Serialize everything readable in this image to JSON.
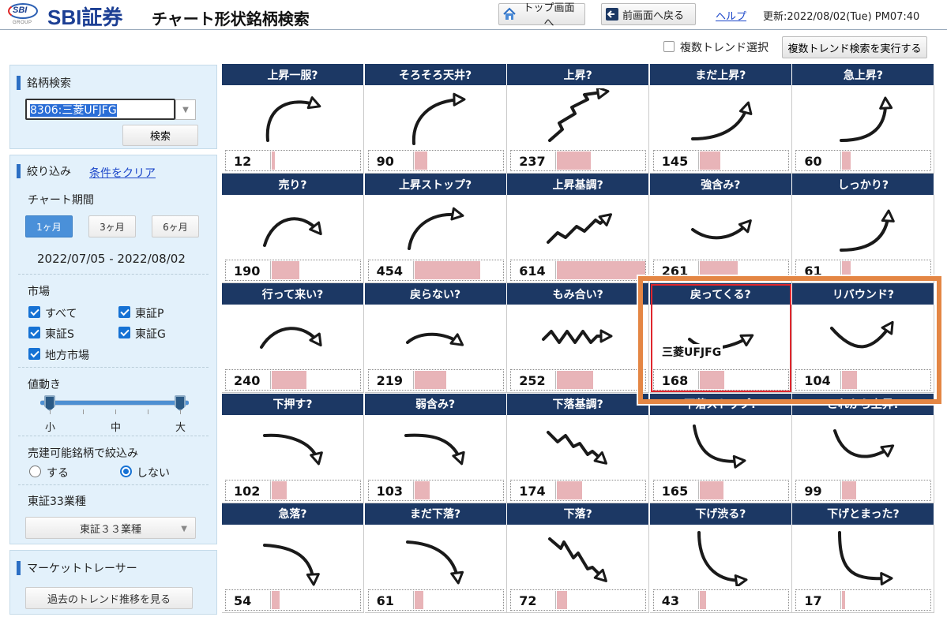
{
  "header": {
    "logo_mark": "SBI",
    "logo_group": "GROUP",
    "brand": "SBI証券",
    "title": "チャート形状銘柄検索",
    "top_button": "トップ画面へ",
    "back_button": "前画面へ戻る",
    "help": "ヘルプ",
    "updated": "更新:2022/08/02(Tue) PM07:40"
  },
  "toolbar": {
    "multi_trend_label": "複数トレンド選択",
    "multi_trend_run": "複数トレンド検索を実行する"
  },
  "sidebar": {
    "search": {
      "title": "銘柄検索",
      "input_value": "8306:三菱UFJFG",
      "button": "検索"
    },
    "filter": {
      "title": "絞り込み",
      "clear": "条件をクリア",
      "period_label": "チャート期間",
      "periods": [
        "1ヶ月",
        "3ヶ月",
        "6ヶ月"
      ],
      "active_period": 0,
      "date_range": "2022/07/05 - 2022/08/02",
      "market_label": "市場",
      "markets": [
        "すべて",
        "東証P",
        "東証S",
        "東証G",
        "地方市場"
      ],
      "volatility_label": "値動き",
      "volatility_ticks": [
        "小",
        "中",
        "大"
      ],
      "shortable_label": "売建可能銘柄で絞込み",
      "shortable_options": [
        "する",
        "しない"
      ],
      "shortable_selected": 1,
      "industry_label": "東証33業種",
      "industry_select": "東証３３業種"
    },
    "tracer": {
      "title": "マーケットトレーサー",
      "button": "過去のトレンド推移を見る"
    }
  },
  "grid": {
    "max_count": 614,
    "cells": [
      {
        "label": "上昇一服?",
        "count": 12
      },
      {
        "label": "そろそろ天井?",
        "count": 90
      },
      {
        "label": "上昇?",
        "count": 237
      },
      {
        "label": "まだ上昇?",
        "count": 145
      },
      {
        "label": "急上昇?",
        "count": 60
      },
      {
        "label": "売り?",
        "count": 190
      },
      {
        "label": "上昇ストップ?",
        "count": 454
      },
      {
        "label": "上昇基調?",
        "count": 614
      },
      {
        "label": "強含み?",
        "count": 261
      },
      {
        "label": "しっかり?",
        "count": 61
      },
      {
        "label": "行って来い?",
        "count": 240
      },
      {
        "label": "戻らない?",
        "count": 219
      },
      {
        "label": "もみ合い?",
        "count": 252
      },
      {
        "label": "戻ってくる?",
        "count": 168
      },
      {
        "label": "リバウンド?",
        "count": 104
      },
      {
        "label": "下押す?",
        "count": 102
      },
      {
        "label": "弱含み?",
        "count": 103
      },
      {
        "label": "下落基調?",
        "count": 174
      },
      {
        "label": "下落ストップ?",
        "count": 165
      },
      {
        "label": "これから上昇?",
        "count": 99
      },
      {
        "label": "急落?",
        "count": 54
      },
      {
        "label": "まだ下落?",
        "count": 61
      },
      {
        "label": "下落?",
        "count": 72
      },
      {
        "label": "下げ渋る?",
        "count": 43
      },
      {
        "label": "下げとまった?",
        "count": 17
      }
    ]
  },
  "highlight": {
    "stock_tag": "三菱UFJFG"
  }
}
